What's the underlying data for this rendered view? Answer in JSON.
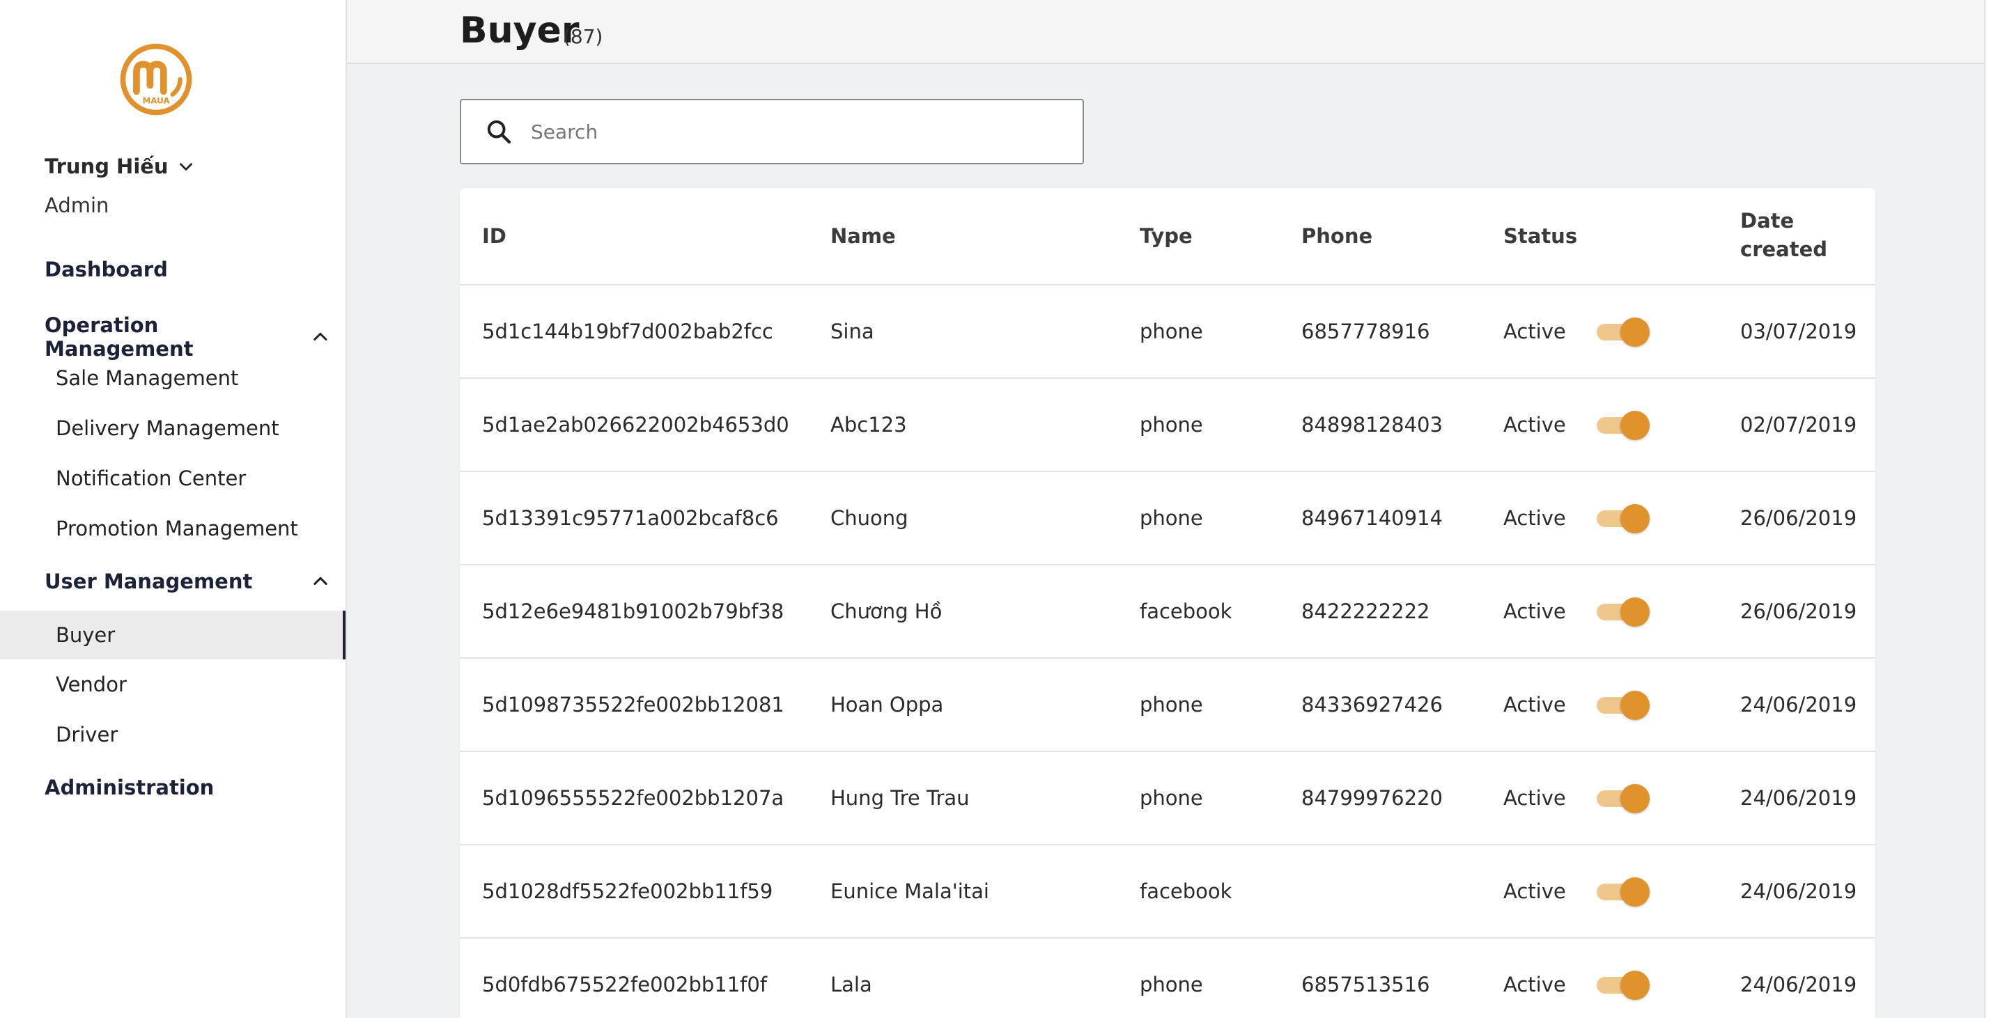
{
  "brand": {
    "logo_text": "MAUA",
    "accent_color": "#e0922c"
  },
  "user": {
    "name": "Trung Hiếu",
    "role": "Admin"
  },
  "nav": {
    "dashboard": "Dashboard",
    "operation_group": "Operation Management",
    "operation_items": [
      "Sale Management",
      "Delivery Management",
      "Notification Center",
      "Promotion Management"
    ],
    "user_group": "User Management",
    "user_items": [
      "Buyer",
      "Vendor",
      "Driver"
    ],
    "active_item": "Buyer",
    "administration": "Administration"
  },
  "page": {
    "title": "Buyer",
    "count": "(87)"
  },
  "search": {
    "placeholder": "Search",
    "value": ""
  },
  "table": {
    "headers": {
      "id": "ID",
      "name": "Name",
      "type": "Type",
      "phone": "Phone",
      "status": "Status",
      "date_line1": "Date",
      "date_line2": "created"
    },
    "rows": [
      {
        "id": "5d1c144b19bf7d002bab2fcc",
        "name": "Sina",
        "type": "phone",
        "phone": "6857778916",
        "status": "Active",
        "enabled": true,
        "date": "03/07/2019"
      },
      {
        "id": "5d1ae2ab026622002b4653d0",
        "name": "Abc123",
        "type": "phone",
        "phone": "84898128403",
        "status": "Active",
        "enabled": true,
        "date": "02/07/2019"
      },
      {
        "id": "5d13391c95771a002bcaf8c6",
        "name": "Chuong",
        "type": "phone",
        "phone": "84967140914",
        "status": "Active",
        "enabled": true,
        "date": "26/06/2019"
      },
      {
        "id": "5d12e6e9481b91002b79bf38",
        "name": "Chương Hồ",
        "type": "facebook",
        "phone": "8422222222",
        "status": "Active",
        "enabled": true,
        "date": "26/06/2019"
      },
      {
        "id": "5d1098735522fe002bb12081",
        "name": "Hoan Oppa",
        "type": "phone",
        "phone": "84336927426",
        "status": "Active",
        "enabled": true,
        "date": "24/06/2019"
      },
      {
        "id": "5d1096555522fe002bb1207a",
        "name": "Hung Tre Trau",
        "type": "phone",
        "phone": "84799976220",
        "status": "Active",
        "enabled": true,
        "date": "24/06/2019"
      },
      {
        "id": "5d1028df5522fe002bb11f59",
        "name": "Eunice Mala'itai",
        "type": "facebook",
        "phone": "",
        "status": "Active",
        "enabled": true,
        "date": "24/06/2019"
      },
      {
        "id": "5d0fdb675522fe002bb11f0f",
        "name": "Lala",
        "type": "phone",
        "phone": "6857513516",
        "status": "Active",
        "enabled": true,
        "date": "24/06/2019"
      }
    ]
  }
}
